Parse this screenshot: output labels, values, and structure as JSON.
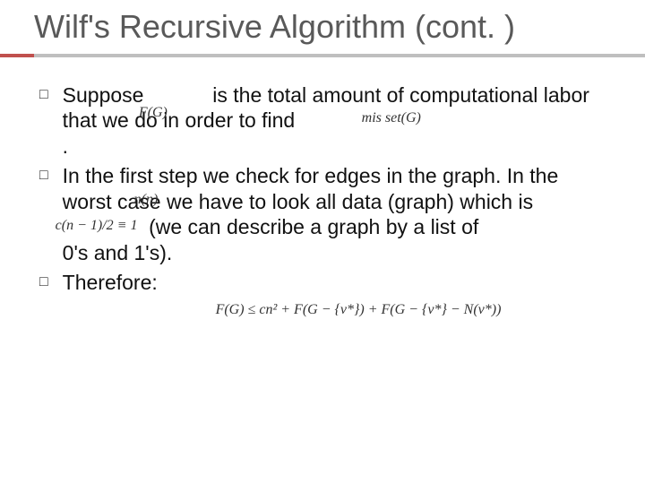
{
  "title": "Wilf's Recursive Algorithm (cont. )",
  "bullets": [
    {
      "text_parts": {
        "a": "Suppose",
        "b": "is the total amount of computational labor that we do in order to find",
        "c": "."
      },
      "overlays": {
        "fg": "F(G)",
        "mis": "mis set(G)"
      }
    },
    {
      "text_parts": {
        "a": "In the first step we check for edges in the graph. In the worst case we have to look all data (graph) which is",
        "b": "(we can describe a graph by a list of",
        "c": "0's and 1's)."
      },
      "overlays": {
        "n2": "n(n)",
        "cn2": "c(n − 1)/2 ≡ 1"
      }
    },
    {
      "text_parts": {
        "a": "Therefore:"
      }
    }
  ],
  "final_formula": "F(G) ≤ cn² + F(G − {v*}) + F(G − {v*} − N(v*))"
}
